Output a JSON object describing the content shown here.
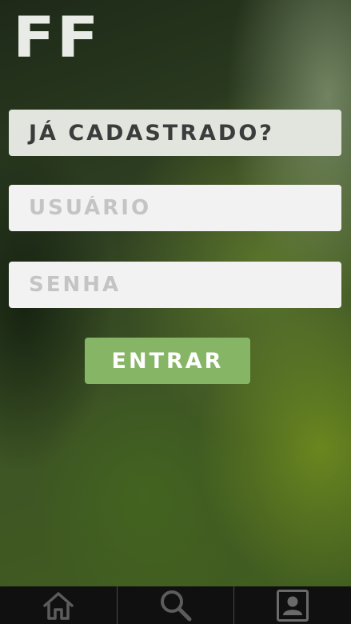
{
  "app": {
    "logo": "FF"
  },
  "login": {
    "heading": "JÁ CADASTRADO?",
    "username_placeholder": "USUÁRIO",
    "password_placeholder": "SENHA",
    "submit_label": "ENTRAR"
  },
  "nav": {
    "items": [
      {
        "icon": "home-icon"
      },
      {
        "icon": "search-icon"
      },
      {
        "icon": "profile-icon"
      }
    ]
  },
  "colors": {
    "button": "#86b565",
    "field": "#f2f2f2",
    "heading_bg": "#e2e4de",
    "nav_bg": "#101010"
  }
}
